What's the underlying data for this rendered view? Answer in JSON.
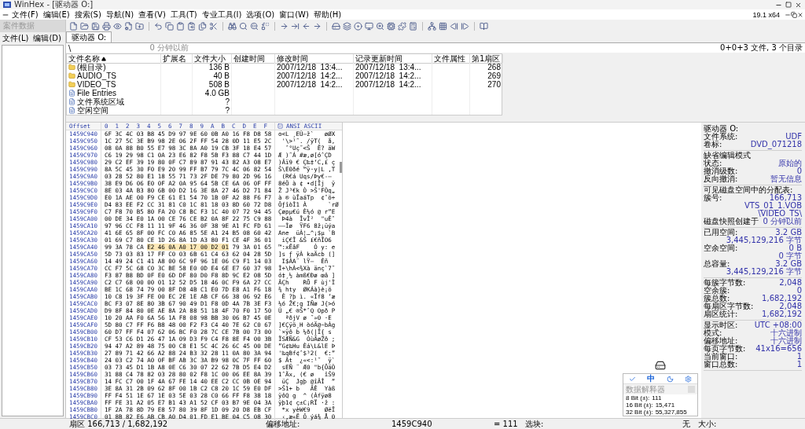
{
  "window": {
    "title": "WinHex - [驱动器 O:]",
    "version": "19.1 x64"
  },
  "menu": [
    "文件(F)",
    "编辑(E)",
    "搜索(S)",
    "导航(N)",
    "查看(V)",
    "工具(T)",
    "专业工具(I)",
    "选项(O)",
    "窗口(W)",
    "帮助(H)"
  ],
  "left_panel": {
    "title": "案件数据",
    "menu": [
      "文件(L)",
      "编辑(D)"
    ]
  },
  "tabs": [
    {
      "label": "驱动器 O:",
      "selected": true
    }
  ],
  "path": "\\",
  "snapshot_age": "0 分钟以前",
  "summary": "0+0+3 文件, 3 个目录",
  "files": {
    "columns": [
      "文件名称",
      "扩展名",
      "文件大小",
      "创建时间",
      "修改时间",
      "记录更新时间",
      "文件属性",
      "第1扇区"
    ],
    "rows": [
      {
        "kind": "folder",
        "name": "(根目录)",
        "size": "136 B",
        "modified": "2007/12/18  13:4...",
        "record_updated": "2007/12/18  13:4...",
        "first_sector": "268"
      },
      {
        "kind": "folder",
        "name": "AUDIO_TS",
        "size": "40 B",
        "modified": "2007/12/18  14:2...",
        "record_updated": "2007/12/18  14:2...",
        "first_sector": "269"
      },
      {
        "kind": "folder",
        "name": "VIDEO_TS",
        "size": "508 B",
        "modified": "2007/12/18  14:2...",
        "record_updated": "2007/12/18  14:2...",
        "first_sector": "270"
      },
      {
        "kind": "file",
        "name": "File Entries",
        "size": "4.0 GB"
      },
      {
        "kind": "file",
        "name": "文件系统区域",
        "size": "?"
      },
      {
        "kind": "file",
        "name": "空闲空间",
        "size": "?"
      }
    ]
  },
  "hex": {
    "offset_label": "Offset",
    "columns": [
      "0",
      "1",
      "2",
      "3",
      "4",
      "5",
      "6",
      "7",
      "8",
      "9",
      "A",
      "B",
      "C",
      "D",
      "E",
      "F"
    ],
    "charset": "ANSI ASCII",
    "rows": [
      {
        "offset": "1459C940",
        "bytes": [
          {
            "text": "6F 3C 4C 03 B8 45 D9 97 9E 60 0B A0 16 F8 D8 58",
            "selected": false
          }
        ],
        "ascii": "o<L ¸EÙ—ž`   øØX"
      },
      {
        "offset": "1459C950",
        "bytes": [
          {
            "text": "1C 27 5C 3E B9 98 2E 06 2F FF 54 28 0D 11 E5 2C",
            "selected": false
          }
        ],
        "ascii": " '\\>¹˜. /ÿT(  å,"
      },
      {
        "offset": "1459C960",
        "bytes": [
          {
            "text": "08 0A 88 B0 55 E7 98 3C 8A A0 19 CB 3F 18 E4 57",
            "selected": false
          }
        ],
        "ascii": "  ˆ°Uç˜<Š  Ë? äW"
      },
      {
        "offset": "1459C970",
        "bytes": [
          {
            "text": "C6 19 29 98 C1 0A 23 E6 82 F8 5B F3 88 C7 44 1D",
            "selected": false
          }
        ],
        "ascii": "Æ )˜Á #æ‚ø[óˆÇD "
      },
      {
        "offset": "1459C980",
        "bytes": [
          {
            "text": "29 C2 EF 39 19 80 0F C7 89 87 91 43 82 A3 08 E7",
            "selected": false
          }
        ],
        "ascii": ")Âï9 € Ç‰‡‘C‚£ ç"
      },
      {
        "offset": "1459C990",
        "bytes": [
          {
            "text": "8A 5C 45 30 F0 E9 20 99 FF B7 79 7C 4C 06 82 54",
            "selected": false
          }
        ],
        "ascii": "Š\\E0ðé ™ÿ·y|L ‚T"
      },
      {
        "offset": "1459C9A0",
        "bytes": [
          {
            "text": "03 28 52 80 E1 18 55 71 73 2F DE 79 80 2D 96 16",
            "selected": false
          }
        ],
        "ascii": " (R€á Uqs/Þy€-– "
      },
      {
        "offset": "1459C9B0",
        "bytes": [
          {
            "text": "38 E9 D6 06 E0 0F A2 0A 95 64 5B CE 6A 06 0F FF",
            "selected": false
          }
        ],
        "ascii": "8éÖ à ¢ •d[Îj  ÿ"
      },
      {
        "offset": "1459C9C0",
        "bytes": [
          {
            "text": "8E 03 4A B3 80 6B 00 D2 16 3E 8A 27 46 D2 71 84",
            "selected": false
          }
        ],
        "ascii": "Ž J³€k Ò >Š'FÒq„"
      },
      {
        "offset": "1459C9D0",
        "bytes": [
          {
            "text": "E0 1A AE 00 F9 CE 61 E1 54 70 1B 0F A2 88 F6 F7",
            "selected": false
          }
        ],
        "ascii": "à ® ùÎaáTp  ¢ˆö÷"
      },
      {
        "offset": "1459C9E0",
        "bytes": [
          {
            "text": "D4 83 EE F2 CC 31 81 C0 1C 81 18 03 8D 60 72 D8",
            "selected": false
          }
        ],
        "ascii": "ÔƒîòÌ1 À      `rØ"
      },
      {
        "offset": "1459C9F0",
        "bytes": [
          {
            "text": "C7 F8 70 B5 80 FA 20 C8 BC F3 1C 40 07 72 94 45",
            "selected": false
          }
        ],
        "ascii": "Çøpµ€ú È¼ó @ r”E"
      },
      {
        "offset": "1459CA00",
        "bytes": [
          {
            "text": "00 DE 34 E0 1A 00 CE 76 CE B2 0A 8F 22 75 C9 88",
            "selected": false
          }
        ],
        "ascii": " Þ4à  ÎvÎ²  \"uÉˆ"
      },
      {
        "offset": "1459CA10",
        "bytes": [
          {
            "text": "97 96 CC F8 11 11 9F 46 36 0F 38 9E A1 FC FD 61",
            "selected": false
          }
        ],
        "ascii": "—–Ìø  ŸF6 8ž¡üýa"
      },
      {
        "offset": "1459CA20",
        "bytes": [
          {
            "text": "41 6E 65 8F 00 FC C0 A6 85 5E A1 24 B5 08 60 42",
            "selected": false
          }
        ],
        "ascii": "Ane  üÀ¦…^¡$µ `B"
      },
      {
        "offset": "1459CA30",
        "bytes": [
          {
            "text": "01 69 C7 80 CE 1D 26 8A 1D A3 80 F1 CE 4F 36 01",
            "selected": false
          }
        ],
        "ascii": " iÇ€Î &Š £€ñÎO6 "
      },
      {
        "offset": "1459CA40",
        "bytes": [
          {
            "text": "99 3A 78 CA",
            "selected": false
          },
          {
            "text": "E2 46 0A A0 17 00 D2 01",
            "selected": true
          },
          {
            "text": "79 3A 01 65",
            "selected": false
          }
        ],
        "ascii": "™:xÊâF    Ò y: e"
      },
      {
        "offset": "1459CA50",
        "bytes": [
          {
            "text": "5D 73 03 83 17 FF C0 03 6B 61 C4 63 62 04 28 5D",
            "selected": false
          }
        ],
        "ascii": "]s ƒ ÿÀ kaÄcb (]"
      },
      {
        "offset": "1459CA60",
        "bytes": [
          {
            "text": "14 49 24 C1 41 A8 00 6C 9F 96 1E 06 C9 F1 14 03",
            "selected": false
          }
        ],
        "ascii": " I$ÁA¨ lŸ–  Éñ  "
      },
      {
        "offset": "1459CA70",
        "bytes": [
          {
            "text": "CC F7 5C 68 C0 3C BE 58 E0 0D E4 6E E7 60 37 98",
            "selected": false
          }
        ],
        "ascii": "Ì÷\\hÀ<¾Xà änç`7˜"
      },
      {
        "offset": "1459CA80",
        "bytes": [
          {
            "text": "F3 87 B8 BD 0F E0 6D DF 80 D0 F8 8D 9C E2 08 5D",
            "selected": false
          }
        ],
        "ascii": "ó‡¸½ àmß€Ðø œâ ]"
      },
      {
        "offset": "1459CA90",
        "bytes": [
          {
            "text": "C2 C7 68 00 00 01 12 52 D5 18 46 0C F9 6A 27 CC",
            "selected": false
          }
        ],
        "ascii": "ÂÇh    RÕ F ùj'Ì"
      },
      {
        "offset": "1459CAA0",
        "bytes": [
          {
            "text": "BE 1C 68 74 79 00 8F D8 4B C1 E0 7D E8 A1 F6 18",
            "selected": false
          }
        ],
        "ascii": "¾ hty  ØKÁà}è¡ö "
      },
      {
        "offset": "1459CAB0",
        "bytes": [
          {
            "text": "10 C8 19 3F FE 00 EC 2E 1E AB CF 66 38 06 92 E6",
            "selected": false
          }
        ],
        "ascii": " È ?þ ì. «Ïf8 ’æ"
      },
      {
        "offset": "1459CAC0",
        "bytes": [
          {
            "text": "BC F3 07 8E 80 3B 67 90 49 D1 F8 0D 4A 7B 3E F3",
            "selected": false
          }
        ],
        "ascii": "¼ó Ž€;g IÑø J{>ó"
      },
      {
        "offset": "1459CAD0",
        "bytes": [
          {
            "text": "D9 8F 84 80 0E AE 8A 2A 88 51 18 4F 70 F0 17 50",
            "selected": false
          }
        ],
        "ascii": "Ù „€ ®Š*ˆQ Opð P"
      },
      {
        "offset": "1459CAE0",
        "bytes": [
          {
            "text": "10 20 AA F0 6A 56 1A F8 08 98 BB 30 06 B7 45 0E",
            "selected": false
          }
        ],
        "ascii": "  ªðjV ø ˜»0 ·E "
      },
      {
        "offset": "1459CAF0",
        "bytes": [
          {
            "text": "5D 80 C7 FF F6 B8 48 00 F2 F3 C4 40 7E 62 C0 67",
            "selected": false
          }
        ],
        "ascii": "]€Çÿö¸H òóÄ@~bÀg"
      },
      {
        "offset": "1459CB00",
        "bytes": [
          {
            "text": "60 D7 FF F4 07 62 06 BC F0 28 7C CE 7B 00 73 00",
            "selected": false
          }
        ],
        "ascii": "`×ÿô b ¼ð(|Î{ s "
      },
      {
        "offset": "1459CB10",
        "bytes": [
          {
            "text": "CF 53 C6 D1 26 47 1A 09 D3 F9 C4 F8 8E F4 00 3B",
            "selected": false
          }
        ],
        "ascii": "ÏSÆÑ&G  ÓùÄøŽô ;"
      },
      {
        "offset": "1459CB20",
        "bytes": [
          {
            "text": "94 47 A2 89 48 75 00 C8 E1 5C 4C 26 6C 45 00 DE",
            "selected": false
          }
        ],
        "ascii": "”G¢‰Hu Èá\\L&lE Þ"
      },
      {
        "offset": "1459CB30",
        "bytes": [
          {
            "text": "27 89 71 42 66 A2 88 24 B3 32 28 11 0A 80 3A 94",
            "selected": false
          }
        ],
        "ascii": "'‰qBf¢ˆ$³2(  €:”"
      },
      {
        "offset": "1459CB40",
        "bytes": [
          {
            "text": "24 03 C2 74 A0 0F BF AB 3C 3A B9 98 0C 7F FF 60",
            "selected": false
          }
        ],
        "ascii": "$ Ât  ¿«<:¹˜  ÿ`"
      },
      {
        "offset": "1459CB50",
        "bytes": [
          {
            "text": "03 73 45 D1 1B A8 0E C6 30 07 22 62 7B D5 E4 D2",
            "selected": false
          }
        ],
        "ascii": " sEÑ ¨ Æ0 \"b{ÕäÒ"
      },
      {
        "offset": "1459CB60",
        "bytes": [
          {
            "text": "31 88 C4 78 82 03 28 80 02 F8 1C 00 06 EE 8A 39",
            "selected": false
          }
        ],
        "ascii": "1ˆÄx‚ (€ ø   îŠ9"
      },
      {
        "offset": "1459CB70",
        "bytes": [
          {
            "text": "14 FC C7 00 1F 4A 67 FE 14 40 EE C2 CC 0B 0E 94",
            "selected": false
          }
        ],
        "ascii": " üÇ  Jgþ @îÂÌ  ”"
      },
      {
        "offset": "1459CB80",
        "bytes": [
          {
            "text": "3E 8A 31 2B 09 62 8F 00 1B C2 C8 20 1C 59 E0 DF",
            "selected": false
          }
        ],
        "ascii": ">Š1+ b   ÂÈ  Yàß"
      },
      {
        "offset": "1459CB90",
        "bytes": [
          {
            "text": "FF F4 51 1E 67 1E 03 5E 03 28 C0 66 FF F8 38 18",
            "selected": false
          }
        ],
        "ascii": "ÿôQ g  ^ (Àfÿø8 "
      },
      {
        "offset": "1459CBA0",
        "bytes": [
          {
            "text": "FF FE 31 A2 05 E7 B1 43 A1 52 CF 03 B7 9E 04 3A",
            "selected": false
          }
        ],
        "ascii": "ÿþ1¢ ç±C¡RÏ ·ž :"
      },
      {
        "offset": "1459CBB0",
        "bytes": [
          {
            "text": "1F 2A 78 8D 79 E8 57 80 39 8F 1D 09 20 D8 EB CF",
            "selected": false
          }
        ],
        "ascii": " *x yèW€9    ØëÏ"
      },
      {
        "offset": "1459CBC0",
        "bytes": [
          {
            "text": "01 8B 82 E6 AB CB A0 D4 01 FD E1 BE 04 C5 08 30",
            "selected": false
          }
        ],
        "ascii": " ‹‚æ«Ë Ô ýá¾ Å 0"
      }
    ]
  },
  "info_panel": {
    "sections": [
      {
        "rows": [
          {
            "label": "驱动器 O:"
          },
          {
            "label": "文件系统:",
            "value": "UDF"
          },
          {
            "label": "卷标:",
            "value": "DVD_071218"
          }
        ]
      },
      {
        "rows": [
          {
            "label": "缺省编辑模式"
          },
          {
            "label": "状态:",
            "value": "原始的"
          },
          {
            "label": "撤消级数:",
            "value": "0"
          },
          {
            "label": "反向撤消:",
            "value": "暂无信息"
          }
        ]
      },
      {
        "rows": [
          {
            "label": "可见磁盘空间中的分配表:"
          },
          {
            "label": "簇号:",
            "value": "166,713"
          },
          {
            "value": "VTS_01_1.VOB"
          },
          {
            "value": "\\VIDEO_TS\\"
          },
          {
            "label": "磁盘快照创建于",
            "value": "0 分钟以前"
          }
        ]
      },
      {
        "rows": [
          {
            "label": "已用空间:",
            "value": "3.2 GB"
          },
          {
            "value": "3,445,129,216 字节"
          },
          {
            "label": "空余空间:",
            "value": "0 B"
          },
          {
            "value": "0 字节"
          },
          {
            "label": "总容量:",
            "value": "3.2 GB"
          },
          {
            "value": "3,445,129,216 字节"
          }
        ]
      },
      {
        "rows": [
          {
            "label": "每簇字节数:",
            "value": "2,048"
          },
          {
            "label": "空余簇:",
            "value": "0"
          },
          {
            "label": "簇总数:",
            "value": "1,682,192"
          },
          {
            "label": "每扇区字节数:",
            "value": "2,048"
          },
          {
            "label": "扇区统计:",
            "value": "1,682,192"
          }
        ]
      },
      {
        "rows": [
          {
            "label": "显示时区:",
            "value": "UTC +08:00"
          },
          {
            "label": "模式:",
            "value": "十六进制"
          },
          {
            "label": "偏移地址:",
            "value": "十六进制"
          },
          {
            "label": "每页字节数:",
            "value": "41x16=656"
          },
          {
            "label": "当前窗口:",
            "value": "1"
          },
          {
            "label": "窗口总数:",
            "value": "1"
          }
        ]
      }
    ]
  },
  "data_interpreter": {
    "ime_label": "中",
    "title": "数据解释器",
    "rows": [
      {
        "label": "8 Bit (±):",
        "value": "111"
      },
      {
        "label": "16 Bit (±):",
        "value": "15,471"
      },
      {
        "label": "32 Bit (±):",
        "value": "55,327,855"
      }
    ]
  },
  "status_bar": {
    "sector": "扇区 166,713 / 1,682,192",
    "offset_label": "偏移地址:",
    "offset": "1459C940",
    "value": "= 111",
    "block_label": "选块:",
    "block": "无",
    "size_label": "大小:"
  }
}
